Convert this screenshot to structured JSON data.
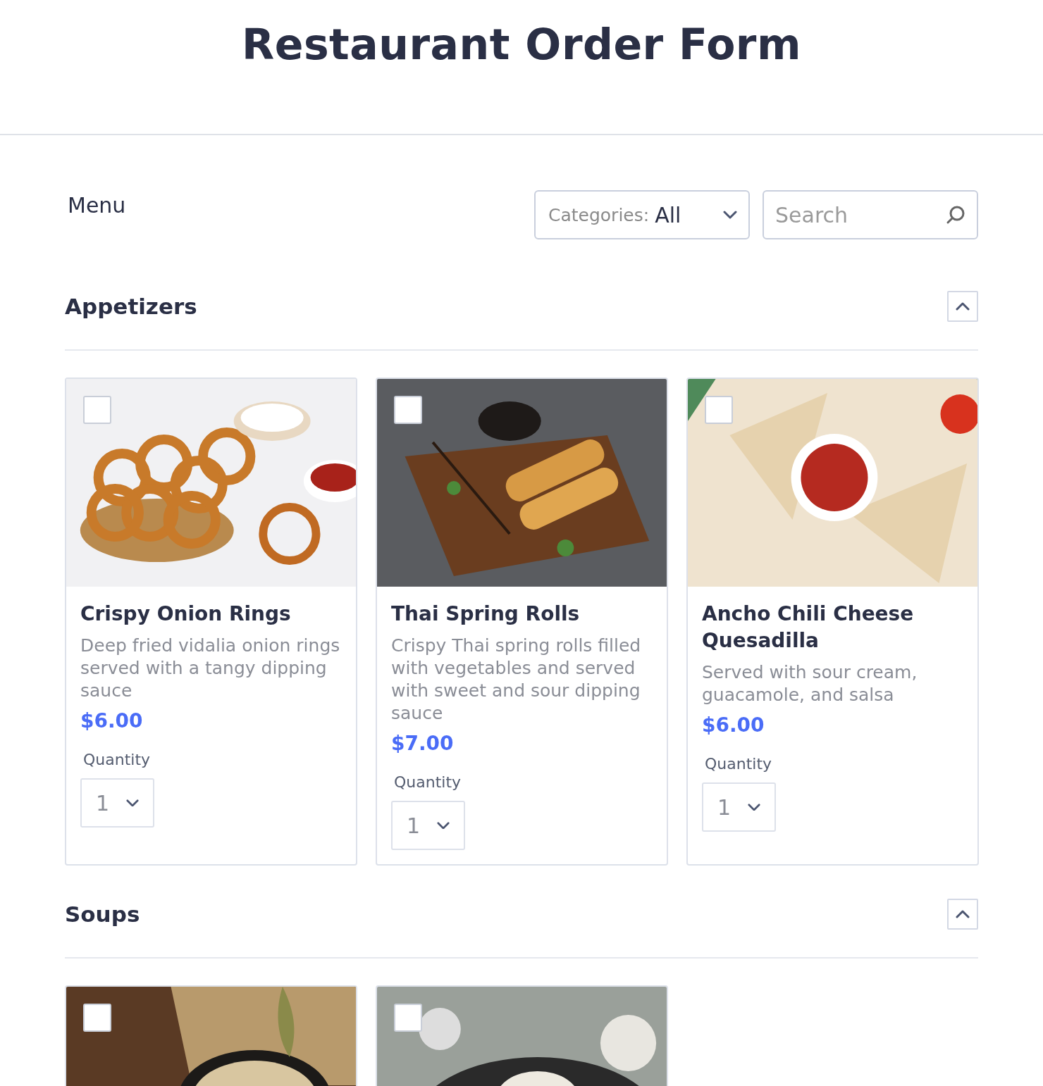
{
  "page": {
    "title": "Restaurant Order Form"
  },
  "menu": {
    "label": "Menu",
    "category_select": {
      "label": "Categories:",
      "value": "All"
    },
    "search": {
      "placeholder": "Search"
    }
  },
  "sections": [
    {
      "title": "Appetizers",
      "expanded": true,
      "items": [
        {
          "name": "Crispy Onion Rings",
          "description": "Deep fried vidalia onion rings served with a tangy dipping sauce",
          "price": "$6.00",
          "checked": false,
          "quantity_label": "Quantity",
          "quantity": "1"
        },
        {
          "name": "Thai Spring Rolls",
          "description": "Crispy Thai spring rolls filled with vegetables and served with sweet and sour dipping sauce",
          "price": "$7.00",
          "checked": false,
          "quantity_label": "Quantity",
          "quantity": "1"
        },
        {
          "name": "Ancho Chili Cheese Quesadilla",
          "description": "Served with sour cream, guacamole, and salsa",
          "price": "$6.00",
          "checked": false,
          "quantity_label": "Quantity",
          "quantity": "1"
        }
      ]
    },
    {
      "title": "Soups",
      "expanded": true,
      "items": [
        {
          "checked": false
        },
        {
          "checked": false
        }
      ]
    }
  ]
}
